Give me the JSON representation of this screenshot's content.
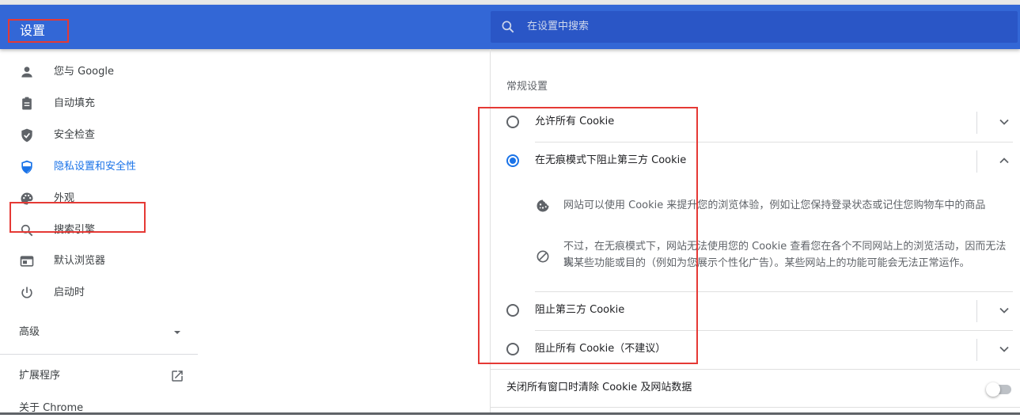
{
  "header": {
    "title": "设置",
    "search_placeholder": "在设置中搜索"
  },
  "sidebar": {
    "items": [
      {
        "label": "您与 Google",
        "icon": "person-icon"
      },
      {
        "label": "自动填充",
        "icon": "clipboard-icon"
      },
      {
        "label": "安全检查",
        "icon": "shield-check-icon"
      },
      {
        "label": "隐私设置和安全性",
        "icon": "shield-privacy-icon",
        "active": true
      },
      {
        "label": "外观",
        "icon": "palette-icon"
      },
      {
        "label": "搜索引擎",
        "icon": "search-icon"
      },
      {
        "label": "默认浏览器",
        "icon": "browser-icon"
      },
      {
        "label": "启动时",
        "icon": "power-icon"
      }
    ],
    "advanced_label": "高级",
    "extensions_label": "扩展程序",
    "about_label": "关于 Chrome"
  },
  "content": {
    "section_title": "常规设置",
    "cookie_options": [
      {
        "label": "允许所有 Cookie",
        "selected": false,
        "expanded": false
      },
      {
        "label": "在无痕模式下阻止第三方 Cookie",
        "selected": true,
        "expanded": true
      },
      {
        "label": "阻止第三方 Cookie",
        "selected": false,
        "expanded": false
      },
      {
        "label": "阻止所有 Cookie（不建议）",
        "selected": false,
        "expanded": false
      }
    ],
    "details": {
      "line1": "网站可以使用 Cookie 来提升您的浏览体验，例如让您保持登录状态或记住您购物车中的商品",
      "line2a": "不过，在无痕模式下，网站无法使用您的 Cookie 查看您在各个不同网站上的浏览活动，因而无法实",
      "line2b": "现某些功能或目的（例如为您展示个性化广告）。某些网站上的功能可能会无法正常运作。"
    },
    "clear_on_exit_label": "关闭所有窗口时清除 Cookie 及网站数据",
    "clear_on_exit_enabled": false
  },
  "colors": {
    "header_blue": "#3367d6",
    "accent_blue": "#1a73e8",
    "highlight_red": "#e53935"
  }
}
